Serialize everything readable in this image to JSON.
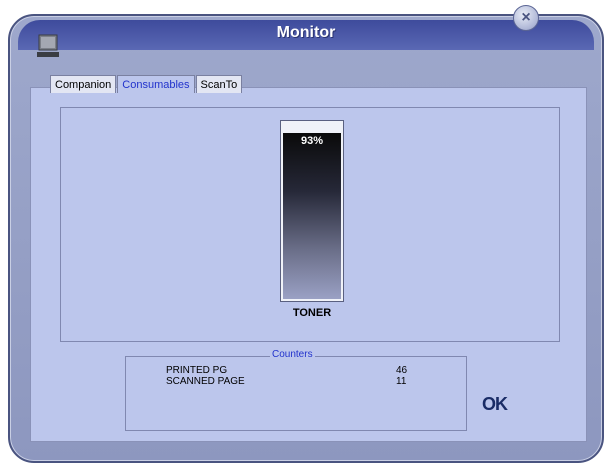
{
  "window": {
    "title": "Monitor",
    "close_label": "×"
  },
  "tabs": [
    {
      "label": "Companion",
      "active": false
    },
    {
      "label": "Consumables",
      "active": true
    },
    {
      "label": "ScanTo",
      "active": false
    }
  ],
  "toner": {
    "level_percent": 93,
    "level_text": "93%",
    "label": "TONER"
  },
  "counters": {
    "legend": "Counters",
    "rows": [
      {
        "label": "PRINTED PG",
        "value": "46"
      },
      {
        "label": "SCANNED PAGE",
        "value": "11"
      }
    ]
  },
  "ok_label": "OK",
  "colors": {
    "accent": "#2233cc",
    "panel": "#bcc6ec",
    "frame": "#8d97bf"
  }
}
